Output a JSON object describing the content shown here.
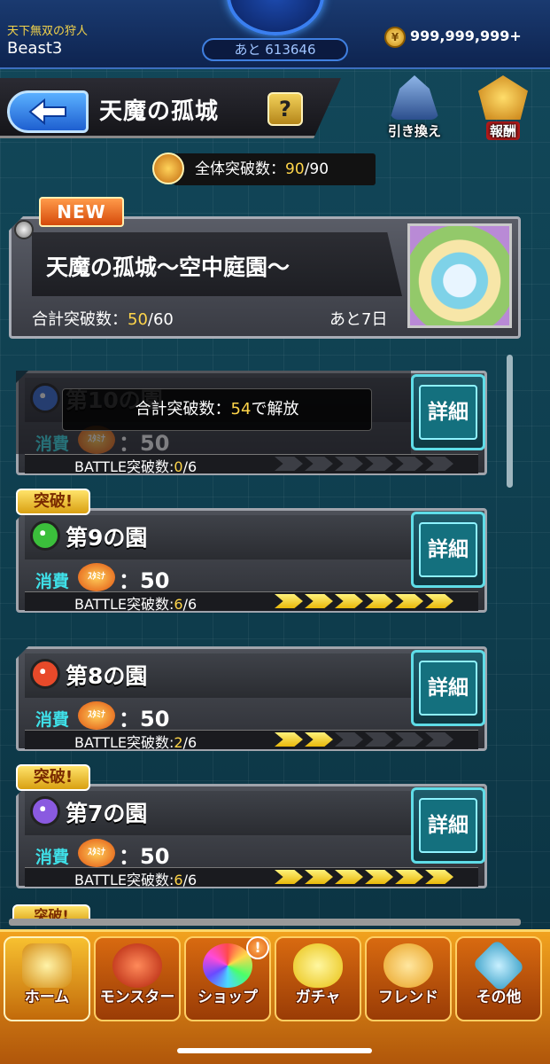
{
  "status": {
    "player_title": "天下無双の狩人",
    "player_name": "Beast3",
    "exp_remaining": "あと 613646",
    "gold_icon": "gold-coin-icon",
    "gold": "999,999,999+"
  },
  "header": {
    "title": "天魔の孤城",
    "help_label": "?",
    "exchange_label": "引き換え",
    "reward_label": "報酬"
  },
  "total_break": {
    "label": "全体突破数：",
    "current": "90",
    "sep": "/",
    "max": "90"
  },
  "event": {
    "new_label": "NEW",
    "name": "天魔の孤城～空中庭園～",
    "sum_label": "合計突破数：",
    "sum_current": "50",
    "sum_max": "/60",
    "remaining": "あと7日"
  },
  "stages": [
    {
      "name": "第10の園",
      "element": "dark",
      "color": "#3a6fd8",
      "cost_label": "消費",
      "stamina_label": "ｽﾀﾐﾅ",
      "cost": "：50",
      "battle_label": "BATTLE突破数:",
      "battle_done": "0",
      "battle_total": "/6",
      "progress": 0,
      "locked": true,
      "lock_label": "合計突破数：",
      "lock_value": "54",
      "lock_suffix": "で解放",
      "detail_label": "詳細"
    },
    {
      "name": "第9の園",
      "element": "wood",
      "color": "#3bbf3b",
      "cost_label": "消費",
      "stamina_label": "ｽﾀﾐﾅ",
      "cost": "：50",
      "battle_label": "BATTLE突破数:",
      "battle_done": "6",
      "battle_total": "/6",
      "progress": 1.0,
      "locked": false,
      "break_label": "突破!",
      "detail_label": "詳細"
    },
    {
      "name": "第8の園",
      "element": "fire",
      "color": "#e84a2a",
      "cost_label": "消費",
      "stamina_label": "ｽﾀﾐﾅ",
      "cost": "：50",
      "battle_label": "BATTLE突破数:",
      "battle_done": "2",
      "battle_total": "/6",
      "progress": 0.3333,
      "locked": false,
      "detail_label": "詳細"
    },
    {
      "name": "第7の園",
      "element": "dark",
      "color": "#8a5ae0",
      "cost_label": "消費",
      "stamina_label": "ｽﾀﾐﾅ",
      "cost": "：50",
      "battle_label": "BATTLE突破数:",
      "battle_done": "6",
      "battle_total": "/6",
      "progress": 1.0,
      "locked": false,
      "break_label": "突破!",
      "detail_label": "詳細"
    }
  ],
  "partial_break_label": "突破!",
  "nav": {
    "home": "ホーム",
    "monster": "モンスター",
    "shop": "ショップ",
    "gacha": "ガチャ",
    "friend": "フレンド",
    "other": "その他",
    "shop_notice": "!"
  }
}
